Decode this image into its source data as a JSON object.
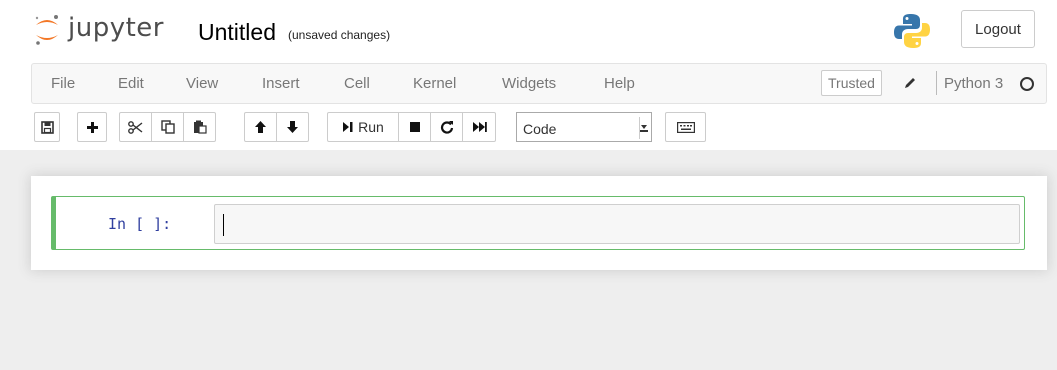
{
  "header": {
    "logo_text": "jupyter",
    "notebook_title": "Untitled",
    "save_status": "(unsaved changes)",
    "logout_label": "Logout"
  },
  "menubar": {
    "items": [
      "File",
      "Edit",
      "View",
      "Insert",
      "Cell",
      "Kernel",
      "Widgets",
      "Help"
    ],
    "trusted_label": "Trusted",
    "kernel_name": "Python 3"
  },
  "toolbar": {
    "run_label": "Run",
    "cell_type_value": "Code",
    "icons": [
      "save-icon",
      "plus-icon",
      "cut-icon",
      "copy-icon",
      "paste-icon",
      "arrow-up-icon",
      "arrow-down-icon",
      "step-forward-icon",
      "stop-icon",
      "restart-icon",
      "fast-forward-icon",
      "keyboard-icon"
    ]
  },
  "notebook": {
    "cells": [
      {
        "prompt": "In [ ]:",
        "source": ""
      }
    ]
  },
  "colors": {
    "logo_orange": "#f37726",
    "cell_selected_border": "#66bb6a",
    "prompt_blue": "#303f9f",
    "site_background": "#eeeeee"
  }
}
